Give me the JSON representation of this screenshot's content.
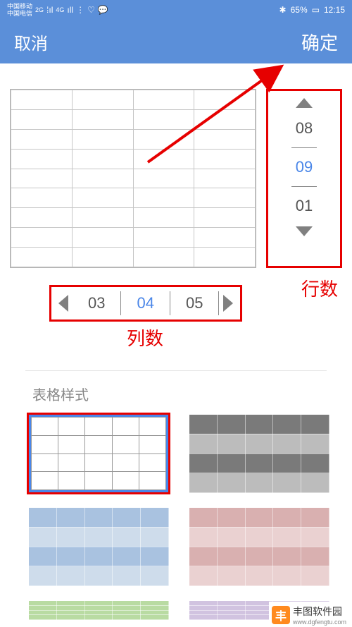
{
  "status": {
    "carrier1": "中国移动",
    "carrier2": "中国电信",
    "net1": "2G",
    "net2": "4G",
    "bluetooth": "✱",
    "battery_pct": "65%",
    "time": "12:15"
  },
  "header": {
    "cancel": "取消",
    "confirm": "确定"
  },
  "preview": {
    "rows": 9,
    "cols": 4
  },
  "row_spinner": {
    "prev": "08",
    "current": "09",
    "next": "01",
    "label": "行数"
  },
  "col_spinner": {
    "prev": "03",
    "current": "04",
    "next": "05",
    "label": "列数"
  },
  "section_title": "表格样式",
  "styles": {
    "plain": {
      "rows": 4,
      "cols": 5
    },
    "gray": {
      "rows": 4,
      "cols": 5
    },
    "blue": {
      "rows": 4,
      "cols": 5
    },
    "red": {
      "rows": 4,
      "cols": 5
    },
    "green": {
      "rows": 4,
      "cols": 5
    },
    "purple": {
      "rows": 4,
      "cols": 5
    }
  },
  "watermark": {
    "name": "丰图软件园",
    "url": "www.dgfengtu.com"
  }
}
